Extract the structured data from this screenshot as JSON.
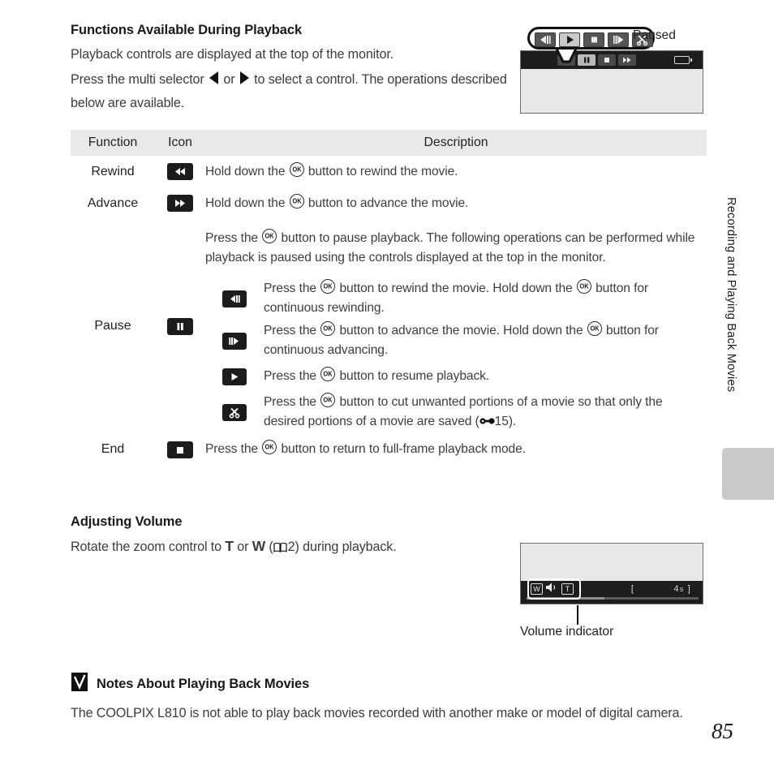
{
  "page": {
    "number": "85",
    "running_header": "Recording and Playing Back Movies"
  },
  "section_playback": {
    "heading": "Functions Available During Playback",
    "para1": "Playback controls are displayed at the top of the monitor.",
    "para2_a": "Press the multi selector",
    "para2_b": "or",
    "para2_c": "to select a control. The",
    "para2_d": "operations described below are available."
  },
  "monitor_paused": {
    "caption": "Paused",
    "bar_buttons": [
      "rewind-icon",
      "pause-icon",
      "stop-icon",
      "advance-icon"
    ],
    "selected_index": 1,
    "battery": "battery-icon",
    "callout_buttons": [
      "rewind-step-icon",
      "play-icon",
      "stop-icon",
      "advance-step-icon",
      "scissors-icon"
    ],
    "callout_selected_index": 1
  },
  "table": {
    "headers": [
      "Function",
      "Icon",
      "Description"
    ],
    "rows": [
      {
        "function": "Rewind",
        "icon": "rewind-icon",
        "description_pre": "Hold down the",
        "description_post": "button to rewind the movie."
      },
      {
        "function": "Advance",
        "icon": "advance-icon",
        "description_pre": "Hold down the",
        "description_post": "button to advance the movie."
      },
      {
        "function": "Pause",
        "icon": "pause-icon",
        "description_pre": "Press the",
        "description_post": "button to pause playback. The following operations can be performed while playback is paused using the controls displayed at the top in the monitor.",
        "subrows": [
          {
            "icon": "rewind-step-icon",
            "pre": "Press the",
            "mid": "button to rewind the movie. Hold down the",
            "post": "button for continuous rewinding."
          },
          {
            "icon": "advance-step-icon",
            "pre": "Press the",
            "mid": "button to advance the movie. Hold down the",
            "post": "button for continuous advancing."
          },
          {
            "icon": "play-icon",
            "pre": "Press the",
            "mid": "button to resume playback.",
            "post": ""
          },
          {
            "icon": "scissors-icon",
            "pre": "Press the",
            "mid": "button to cut unwanted portions of a movie so that only the desired portions of a movie are saved (",
            "ref": "15",
            "post": ")."
          }
        ]
      },
      {
        "function": "End",
        "icon": "stop-icon",
        "description_pre": "Press the",
        "description_post": "button to return to full-frame playback mode."
      }
    ]
  },
  "section_volume": {
    "heading": "Adjusting Volume",
    "para_a": "Rotate the zoom control to",
    "zoom_tele": "T",
    "para_b": "or",
    "zoom_wide": "W",
    "para_c": "(",
    "page_ref": "2",
    "para_d": ") during playback."
  },
  "monitor_volume": {
    "caption": "Volume indicator",
    "wide_label": "W",
    "tele_label": "T",
    "speaker": "speaker-icon",
    "time_open": "[",
    "time_value": "4",
    "time_unit": "s",
    "time_close": "]"
  },
  "notes": {
    "mark": "caution-checkmark-icon",
    "heading": "Notes About Playing Back Movies",
    "body": "The COOLPIX L810 is not able to play back movies recorded with another make or model of digital camera."
  }
}
